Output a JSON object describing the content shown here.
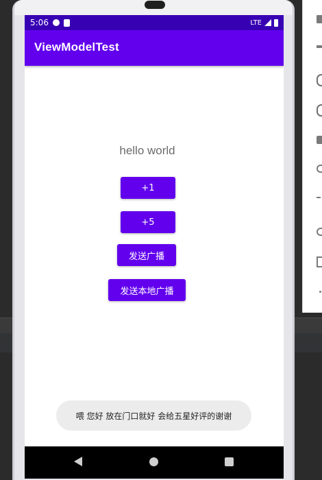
{
  "status_bar": {
    "time": "5:06",
    "network": "LTE"
  },
  "app_bar": {
    "title": "ViewModelTest"
  },
  "content": {
    "hello_text": "hello world",
    "buttons": {
      "plus_one": "+1",
      "plus_five": "+5",
      "send_broadcast": "发送广播",
      "send_local_broadcast": "发送本地广播"
    }
  },
  "toast": {
    "message": "喂 您好 放在门口就好 会给五星好评的谢谢"
  },
  "icons": {
    "status": [
      "cloud-sync-icon",
      "sd-card-icon",
      "signal-icon",
      "battery-icon"
    ],
    "nav": [
      "nav-back-icon",
      "nav-home-icon",
      "nav-recents-icon"
    ],
    "toolbar": [
      "volume-up-icon",
      "volume-down-icon",
      "rotate-left-icon",
      "rotate-right-icon",
      "camera-icon",
      "zoom-in-icon",
      "back-icon",
      "home-icon",
      "overview-icon",
      "more-icon"
    ]
  },
  "colors": {
    "primary": "#6200ee",
    "primary_dark": "#3700b3",
    "toast_bg": "#ececec"
  }
}
